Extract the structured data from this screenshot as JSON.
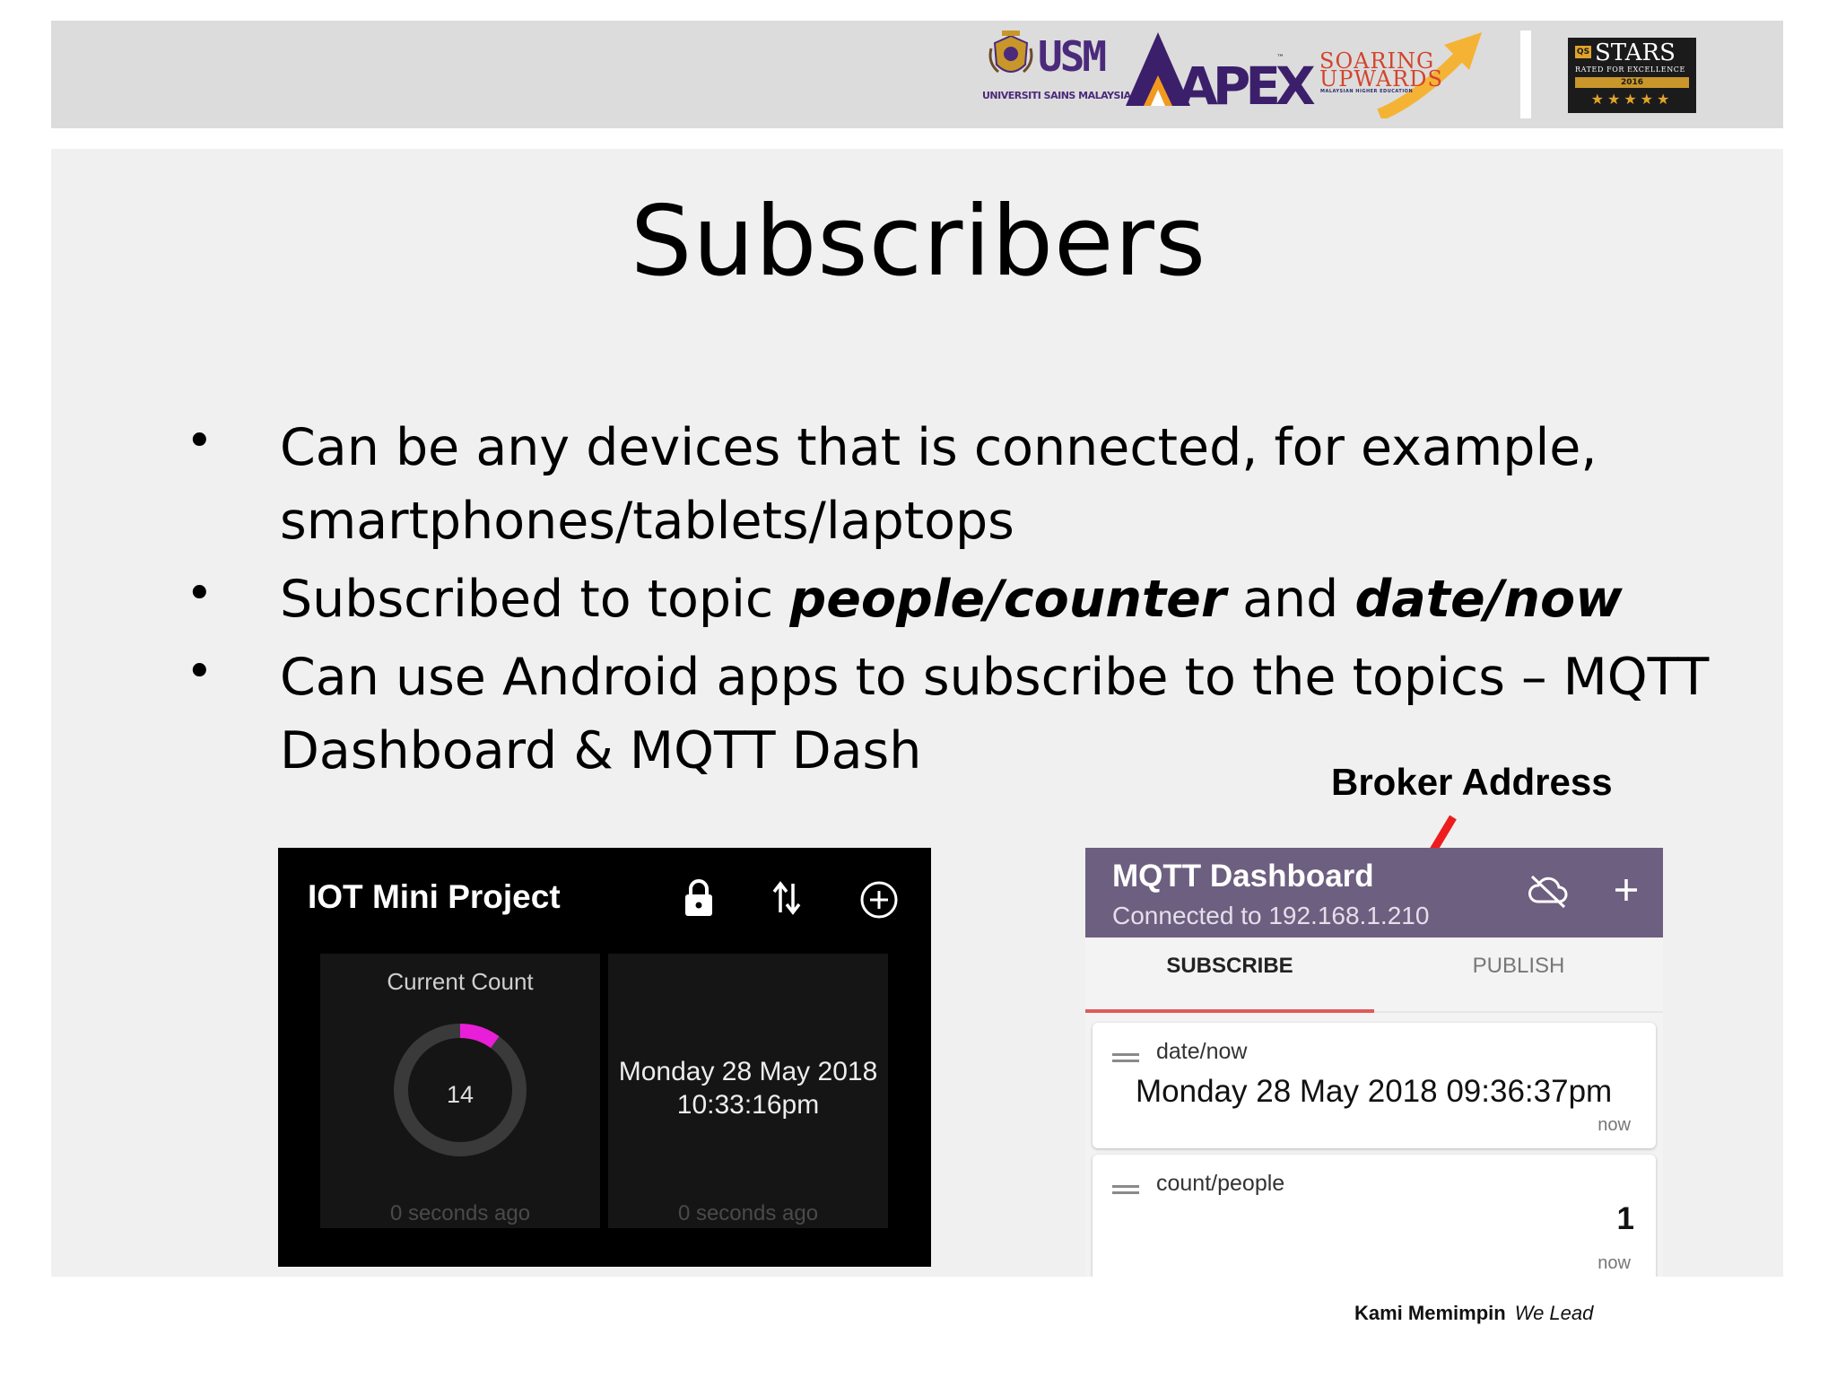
{
  "header": {
    "usm_logo": {
      "word": "USM",
      "subtitle": "UNIVERSITI SAINS MALAYSIA"
    },
    "apex_logo": {
      "word": "APEX",
      "tm": "™"
    },
    "soaring_logo": {
      "line1": "SOARING",
      "line2": "UPWARDS",
      "line3": "MALAYSIAN HIGHER EDUCATION"
    },
    "qs_logo": {
      "badge": "QS",
      "word": "STARS",
      "rated": "RATED FOR EXCELLENCE",
      "year": "2016",
      "stars": "★★★★★"
    }
  },
  "slide": {
    "title": "Subscribers",
    "bullet_symbol": "•",
    "bullets": [
      {
        "line1": "Can be any devices that is connected, for example,",
        "line2": "smartphones/tablets/laptops"
      },
      {
        "prefix": "Subscribed to topic ",
        "topic1": "people/counter",
        "middle": " and ",
        "topic2": "date/now"
      },
      {
        "line1": "Can use Android apps to subscribe to the topics – MQTT",
        "line2": "Dashboard & MQTT Dash"
      }
    ],
    "annotation": "Broker Address"
  },
  "iot_app": {
    "title": "IOT Mini Project",
    "icons": [
      "lock-icon",
      "swap-vertical-icon",
      "add-circle-icon"
    ],
    "count_tile": {
      "label": "Current Count",
      "value": "14",
      "gauge_fraction": 0.1,
      "accent_color": "#e91ed8",
      "footer": "0 seconds ago"
    },
    "date_tile": {
      "line1": "Monday 28 May 2018",
      "line2": "10:33:16pm",
      "footer": "0 seconds ago"
    }
  },
  "mqtt_app": {
    "title": "MQTT Dashboard",
    "subtitle": "Connected to 192.168.1.210",
    "appbar_color": "#6d5f80",
    "icons": [
      "cloud-off-icon",
      "plus-icon"
    ],
    "tabs": [
      {
        "label": "SUBSCRIBE"
      },
      {
        "label": "PUBLISH"
      }
    ],
    "cards": [
      {
        "topic": "date/now",
        "value": "Monday 28 May 2018 09:36:37pm",
        "time": "now"
      },
      {
        "topic": "count/people",
        "value": "1",
        "time": "now"
      }
    ]
  },
  "footer": {
    "malay": "Kami Memimpin",
    "english": "We Lead"
  }
}
